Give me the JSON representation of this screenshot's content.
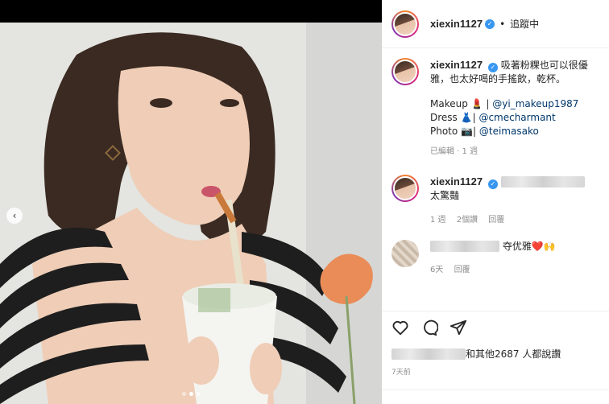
{
  "post": {
    "username": "xiexin1127",
    "verified_badge": "verified-icon",
    "follow_separator": "•",
    "follow_label": "追蹤中",
    "caption_text": "吸著粉粿也可以很優雅，也太好喝的手搖飲，乾杯。",
    "credits": [
      {
        "label": "Makeup 💄",
        "sep": "|",
        "handle": "@yi_makeup1987"
      },
      {
        "label": "Dress 👗",
        "sep": "|",
        "handle": "@cmecharmant"
      },
      {
        "label": "Photo 📷",
        "sep": "|",
        "handle": "@teimasako"
      }
    ],
    "caption_meta": "已編輯 · 1 週"
  },
  "comments": [
    {
      "username": "xiexin1127",
      "text": "太驚豔",
      "time": "1 週",
      "likes": "2個讚",
      "reply": "回覆"
    },
    {
      "text": "夺优雅❤️🙌",
      "time": "6天",
      "reply": "回覆"
    }
  ],
  "footer": {
    "likes_text": "和其他2687 人都說讚",
    "time": "7天前"
  },
  "icons": {
    "like": "heart-icon",
    "comment": "comment-icon",
    "share": "send-icon"
  }
}
